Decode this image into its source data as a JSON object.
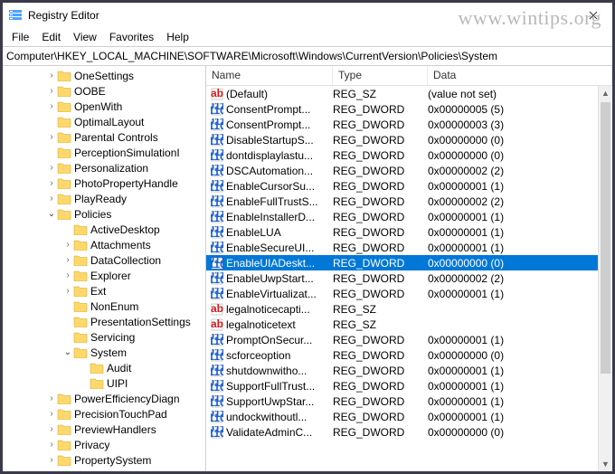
{
  "watermark": "www.wintips.org",
  "window": {
    "title": "Registry Editor"
  },
  "menu": {
    "file": "File",
    "edit": "Edit",
    "view": "View",
    "favorites": "Favorites",
    "help": "Help"
  },
  "address": "Computer\\HKEY_LOCAL_MACHINE\\SOFTWARE\\Microsoft\\Windows\\CurrentVersion\\Policies\\System",
  "tree": [
    {
      "depth": 0,
      "expand": "closed",
      "label": "OneSettings"
    },
    {
      "depth": 0,
      "expand": "closed",
      "label": "OOBE"
    },
    {
      "depth": 0,
      "expand": "closed",
      "label": "OpenWith"
    },
    {
      "depth": 0,
      "expand": "none",
      "label": "OptimalLayout"
    },
    {
      "depth": 0,
      "expand": "closed",
      "label": "Parental Controls"
    },
    {
      "depth": 0,
      "expand": "none",
      "label": "PerceptionSimulationI"
    },
    {
      "depth": 0,
      "expand": "closed",
      "label": "Personalization"
    },
    {
      "depth": 0,
      "expand": "closed",
      "label": "PhotoPropertyHandle"
    },
    {
      "depth": 0,
      "expand": "closed",
      "label": "PlayReady"
    },
    {
      "depth": 0,
      "expand": "open",
      "label": "Policies"
    },
    {
      "depth": 1,
      "expand": "none",
      "label": "ActiveDesktop"
    },
    {
      "depth": 1,
      "expand": "closed",
      "label": "Attachments"
    },
    {
      "depth": 1,
      "expand": "closed",
      "label": "DataCollection"
    },
    {
      "depth": 1,
      "expand": "closed",
      "label": "Explorer"
    },
    {
      "depth": 1,
      "expand": "closed",
      "label": "Ext"
    },
    {
      "depth": 1,
      "expand": "none",
      "label": "NonEnum"
    },
    {
      "depth": 1,
      "expand": "none",
      "label": "PresentationSettings"
    },
    {
      "depth": 1,
      "expand": "none",
      "label": "Servicing"
    },
    {
      "depth": 1,
      "expand": "open",
      "label": "System"
    },
    {
      "depth": 2,
      "expand": "none",
      "label": "Audit"
    },
    {
      "depth": 2,
      "expand": "none",
      "label": "UIPI"
    },
    {
      "depth": 0,
      "expand": "closed",
      "label": "PowerEfficiencyDiagn"
    },
    {
      "depth": 0,
      "expand": "closed",
      "label": "PrecisionTouchPad"
    },
    {
      "depth": 0,
      "expand": "closed",
      "label": "PreviewHandlers"
    },
    {
      "depth": 0,
      "expand": "closed",
      "label": "Privacy"
    },
    {
      "depth": 0,
      "expand": "closed",
      "label": "PropertySystem"
    }
  ],
  "columns": {
    "name": "Name",
    "type": "Type",
    "data": "Data"
  },
  "values": [
    {
      "icon": "sz",
      "name": "(Default)",
      "type": "REG_SZ",
      "data": "(value not set)",
      "selected": false
    },
    {
      "icon": "dw",
      "name": "ConsentPrompt...",
      "type": "REG_DWORD",
      "data": "0x00000005 (5)",
      "selected": false
    },
    {
      "icon": "dw",
      "name": "ConsentPrompt...",
      "type": "REG_DWORD",
      "data": "0x00000003 (3)",
      "selected": false
    },
    {
      "icon": "dw",
      "name": "DisableStartupS...",
      "type": "REG_DWORD",
      "data": "0x00000000 (0)",
      "selected": false
    },
    {
      "icon": "dw",
      "name": "dontdisplaylastu...",
      "type": "REG_DWORD",
      "data": "0x00000000 (0)",
      "selected": false
    },
    {
      "icon": "dw",
      "name": "DSCAutomation...",
      "type": "REG_DWORD",
      "data": "0x00000002 (2)",
      "selected": false
    },
    {
      "icon": "dw",
      "name": "EnableCursorSu...",
      "type": "REG_DWORD",
      "data": "0x00000001 (1)",
      "selected": false
    },
    {
      "icon": "dw",
      "name": "EnableFullTrustS...",
      "type": "REG_DWORD",
      "data": "0x00000002 (2)",
      "selected": false
    },
    {
      "icon": "dw",
      "name": "EnableInstallerD...",
      "type": "REG_DWORD",
      "data": "0x00000001 (1)",
      "selected": false
    },
    {
      "icon": "dw",
      "name": "EnableLUA",
      "type": "REG_DWORD",
      "data": "0x00000001 (1)",
      "selected": false
    },
    {
      "icon": "dw",
      "name": "EnableSecureUI...",
      "type": "REG_DWORD",
      "data": "0x00000001 (1)",
      "selected": false
    },
    {
      "icon": "dw",
      "name": "EnableUIADeskt...",
      "type": "REG_DWORD",
      "data": "0x00000000 (0)",
      "selected": true
    },
    {
      "icon": "dw",
      "name": "EnableUwpStart...",
      "type": "REG_DWORD",
      "data": "0x00000002 (2)",
      "selected": false
    },
    {
      "icon": "dw",
      "name": "EnableVirtualizat...",
      "type": "REG_DWORD",
      "data": "0x00000001 (1)",
      "selected": false
    },
    {
      "icon": "sz",
      "name": "legalnoticecapti...",
      "type": "REG_SZ",
      "data": "",
      "selected": false
    },
    {
      "icon": "sz",
      "name": "legalnoticetext",
      "type": "REG_SZ",
      "data": "",
      "selected": false
    },
    {
      "icon": "dw",
      "name": "PromptOnSecur...",
      "type": "REG_DWORD",
      "data": "0x00000001 (1)",
      "selected": false
    },
    {
      "icon": "dw",
      "name": "scforceoption",
      "type": "REG_DWORD",
      "data": "0x00000000 (0)",
      "selected": false
    },
    {
      "icon": "dw",
      "name": "shutdownwitho...",
      "type": "REG_DWORD",
      "data": "0x00000001 (1)",
      "selected": false
    },
    {
      "icon": "dw",
      "name": "SupportFullTrust...",
      "type": "REG_DWORD",
      "data": "0x00000001 (1)",
      "selected": false
    },
    {
      "icon": "dw",
      "name": "SupportUwpStar...",
      "type": "REG_DWORD",
      "data": "0x00000001 (1)",
      "selected": false
    },
    {
      "icon": "dw",
      "name": "undockwithoutl...",
      "type": "REG_DWORD",
      "data": "0x00000001 (1)",
      "selected": false
    },
    {
      "icon": "dw",
      "name": "ValidateAdminC...",
      "type": "REG_DWORD",
      "data": "0x00000000 (0)",
      "selected": false
    }
  ]
}
